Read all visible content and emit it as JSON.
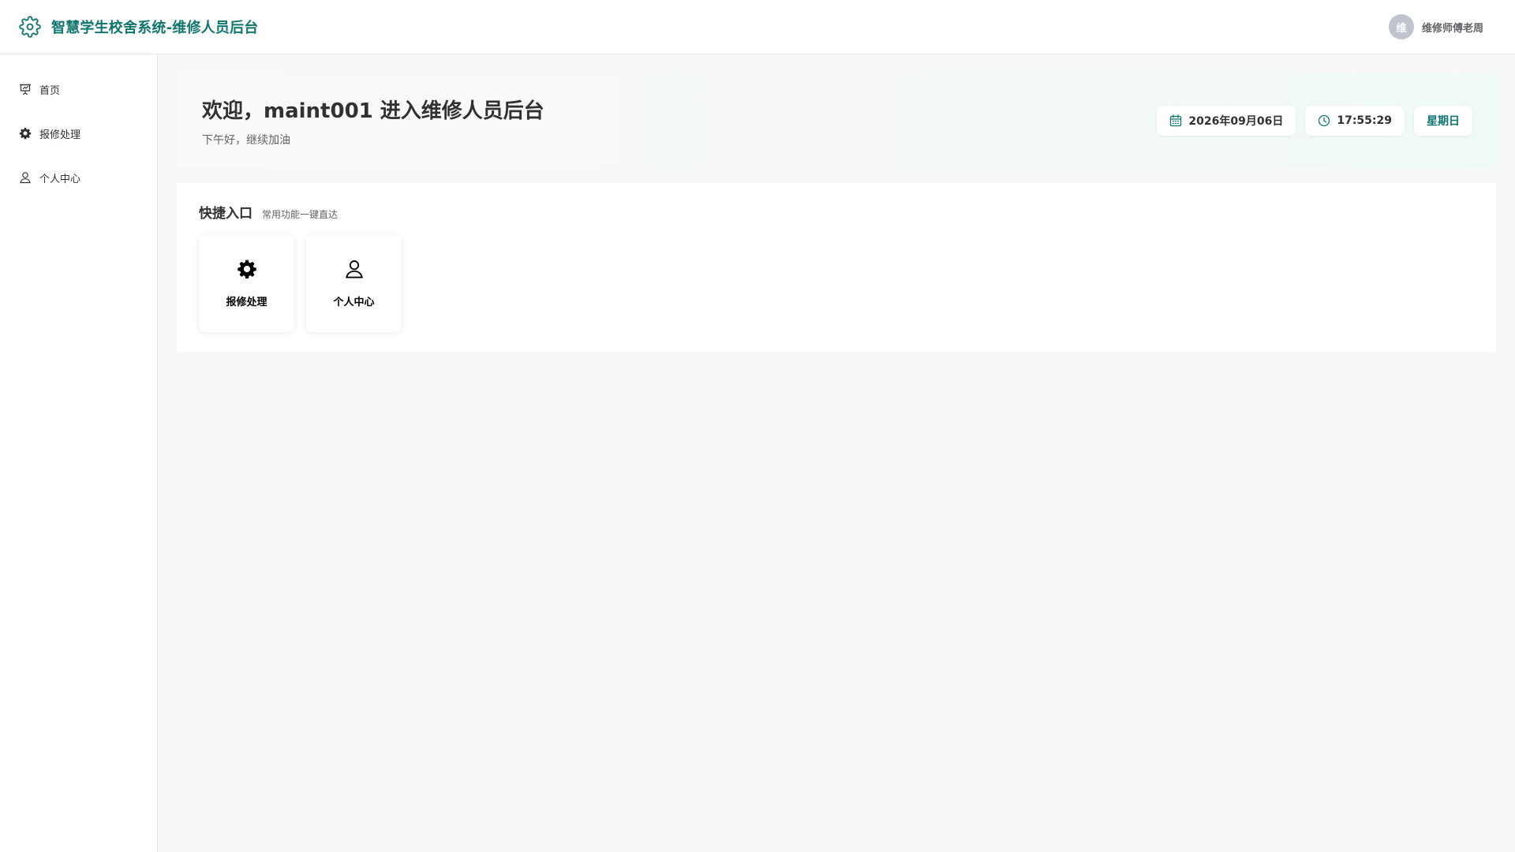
{
  "header": {
    "title": "智慧学生校舍系统-维修人员后台",
    "brand_icon": "gear-icon",
    "user": {
      "avatar_text": "维",
      "name": "维修师傅老周"
    }
  },
  "sidebar": {
    "items": [
      {
        "label": "首页",
        "icon": "presentation-board-icon"
      },
      {
        "label": "报修处理",
        "icon": "gear-icon"
      },
      {
        "label": "个人中心",
        "icon": "user-icon"
      }
    ]
  },
  "welcome": {
    "title": "欢迎，maint001 进入维修人员后台",
    "subtitle": "下午好，继续加油",
    "date": "2026年09月06日",
    "time": "17:55:29",
    "weekday": "星期日"
  },
  "quick": {
    "title": "快捷入口",
    "subtitle": "常用功能一键直达",
    "cards": [
      {
        "label": "报修处理",
        "icon": "gear-icon"
      },
      {
        "label": "个人中心",
        "icon": "user-icon"
      }
    ]
  },
  "colors": {
    "accent": "#0f766e",
    "background": "#f7f8fa",
    "avatar": "#c0c4cc"
  }
}
